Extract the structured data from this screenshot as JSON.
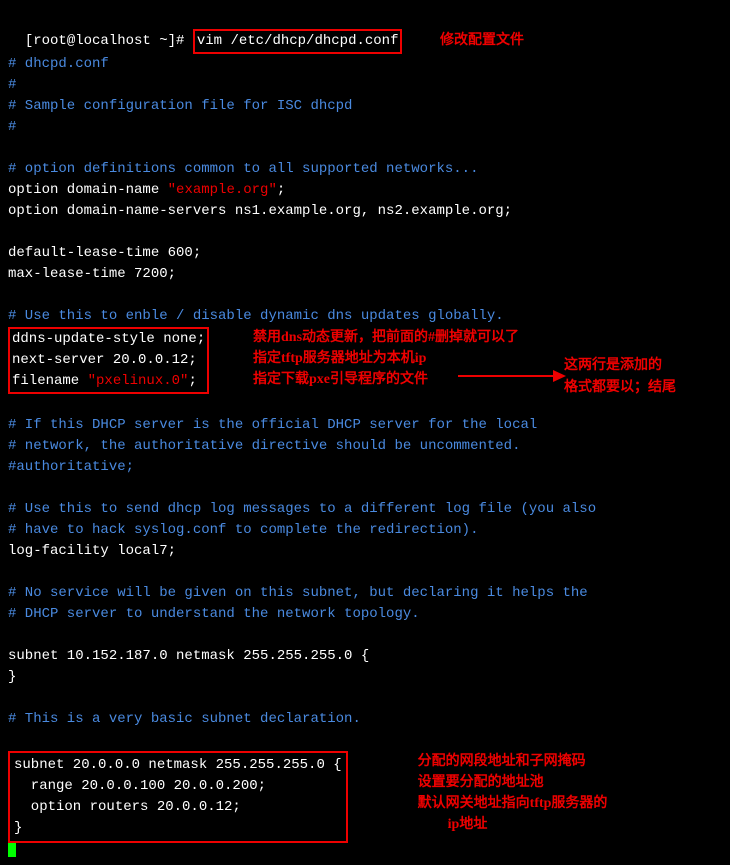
{
  "prompt": "[root@localhost ~]# ",
  "command": "vim /etc/dhcp/dhcpd.conf",
  "anno_title": "修改配置文件",
  "config": {
    "h1": "# dhcpd.conf",
    "h2": "#",
    "h3": "# Sample configuration file for ISC dhcpd",
    "h4": "#",
    "opt_comment": "# option definitions common to all supported networks...",
    "opt_domain_pre": "option domain-name ",
    "opt_domain_val": "\"example.org\"",
    "opt_domain_post": ";",
    "opt_dns": "option domain-name-servers ns1.example.org, ns2.example.org;",
    "default_lease": "default-lease-time 600;",
    "max_lease": "max-lease-time 7200;",
    "ddns_comment": "# Use this to enble / disable dynamic dns updates globally.",
    "ddns_line": "ddns-update-style none;",
    "next_server": "next-server 20.0.0.12;",
    "filename_pre": "filename ",
    "filename_val": "\"pxelinux.0\"",
    "filename_post": ";",
    "anno_ddns": "禁用dns动态更新，把前面的#删掉就可以了",
    "anno_next": "指定tftp服务器地址为本机ip",
    "anno_file": "指定下载pxe引导程序的文件",
    "anno_added1": "这两行是添加的",
    "anno_added2": "格式都要以；结尾",
    "if_comment1": "# If this DHCP server is the official DHCP server for the local",
    "if_comment2": "# network, the authoritative directive should be uncommented.",
    "if_comment3": "#authoritative;",
    "log_comment1": "# Use this to send dhcp log messages to a different log file (you also",
    "log_comment2": "# have to hack syslog.conf to complete the redirection).",
    "log_facility": "log-facility local7;",
    "no_service1": "# No service will be given on this subnet, but declaring it helps the",
    "no_service2": "# DHCP server to understand the network topology.",
    "subnet1": "subnet 10.152.187.0 netmask 255.255.255.0 {",
    "subnet1_close": "}",
    "basic_comment": "# This is a very basic subnet declaration.",
    "subnet2_line1": "subnet 20.0.0.0 netmask 255.255.255.0 {",
    "subnet2_line2": "  range 20.0.0.100 20.0.0.200;",
    "subnet2_line3": "  option routers 20.0.0.12;",
    "subnet2_line4": "}",
    "anno_subnet1": "分配的网段地址和子网掩码",
    "anno_subnet2": "设置要分配的地址池",
    "anno_subnet3": "默认网关地址指向tftp服务器的",
    "anno_subnet4": "ip地址"
  }
}
